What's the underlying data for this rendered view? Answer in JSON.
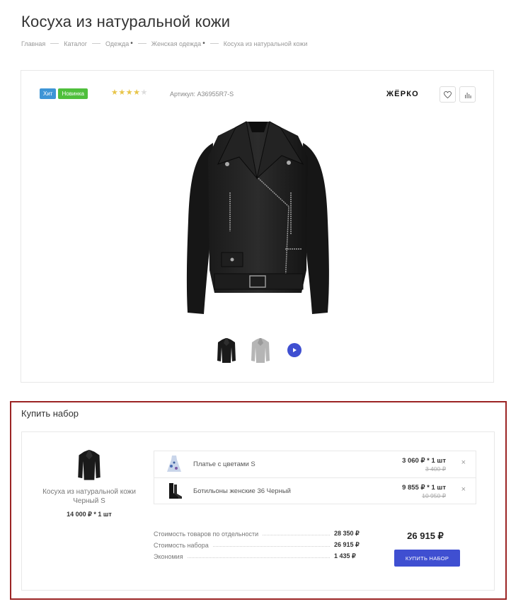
{
  "page": {
    "title": "Косуха из натуральной кожи",
    "breadcrumb": [
      "Главная",
      "Каталог",
      "Одежда",
      "Женская одежда",
      "Косуха из натуральной кожи"
    ]
  },
  "product": {
    "badges": {
      "hit": "Хит",
      "new": "Новинка"
    },
    "rating": 4,
    "rating_max": 5,
    "sku": "Артикул: A36955R7-S",
    "brand": "ЖЁРКО",
    "icons": {
      "favorite": "heart-icon",
      "compare": "bar-chart-icon",
      "video": "play-icon"
    },
    "thumbnails": [
      "jacket-black-thumb",
      "jacket-gray-thumb"
    ],
    "colors": {
      "hit": "#3d95d6",
      "new": "#4fbf3c",
      "accent": "#3f4fd1"
    }
  },
  "bundle": {
    "title": "Купить набор",
    "main_item": {
      "name": "Косуха из натуральной кожи Черный S",
      "price": "14 000 ₽ * 1 шт"
    },
    "items": [
      {
        "name": "Платье с цветами S",
        "price": "3 060 ₽ * 1 шт",
        "old_price": "3 400 ₽",
        "remove": "×"
      },
      {
        "name": "Ботильоны женские 36 Черный",
        "price": "9 855 ₽ * 1 шт",
        "old_price": "10 950 ₽",
        "remove": "×"
      }
    ],
    "summary": [
      {
        "label": "Стоимость товаров по отдельности",
        "value": "28 350 ₽"
      },
      {
        "label": "Стоимость набора",
        "value": "26 915 ₽"
      },
      {
        "label": "Экономия",
        "value": "1 435 ₽"
      }
    ],
    "total": "26 915 ₽",
    "buy_label": "Купить набор"
  }
}
